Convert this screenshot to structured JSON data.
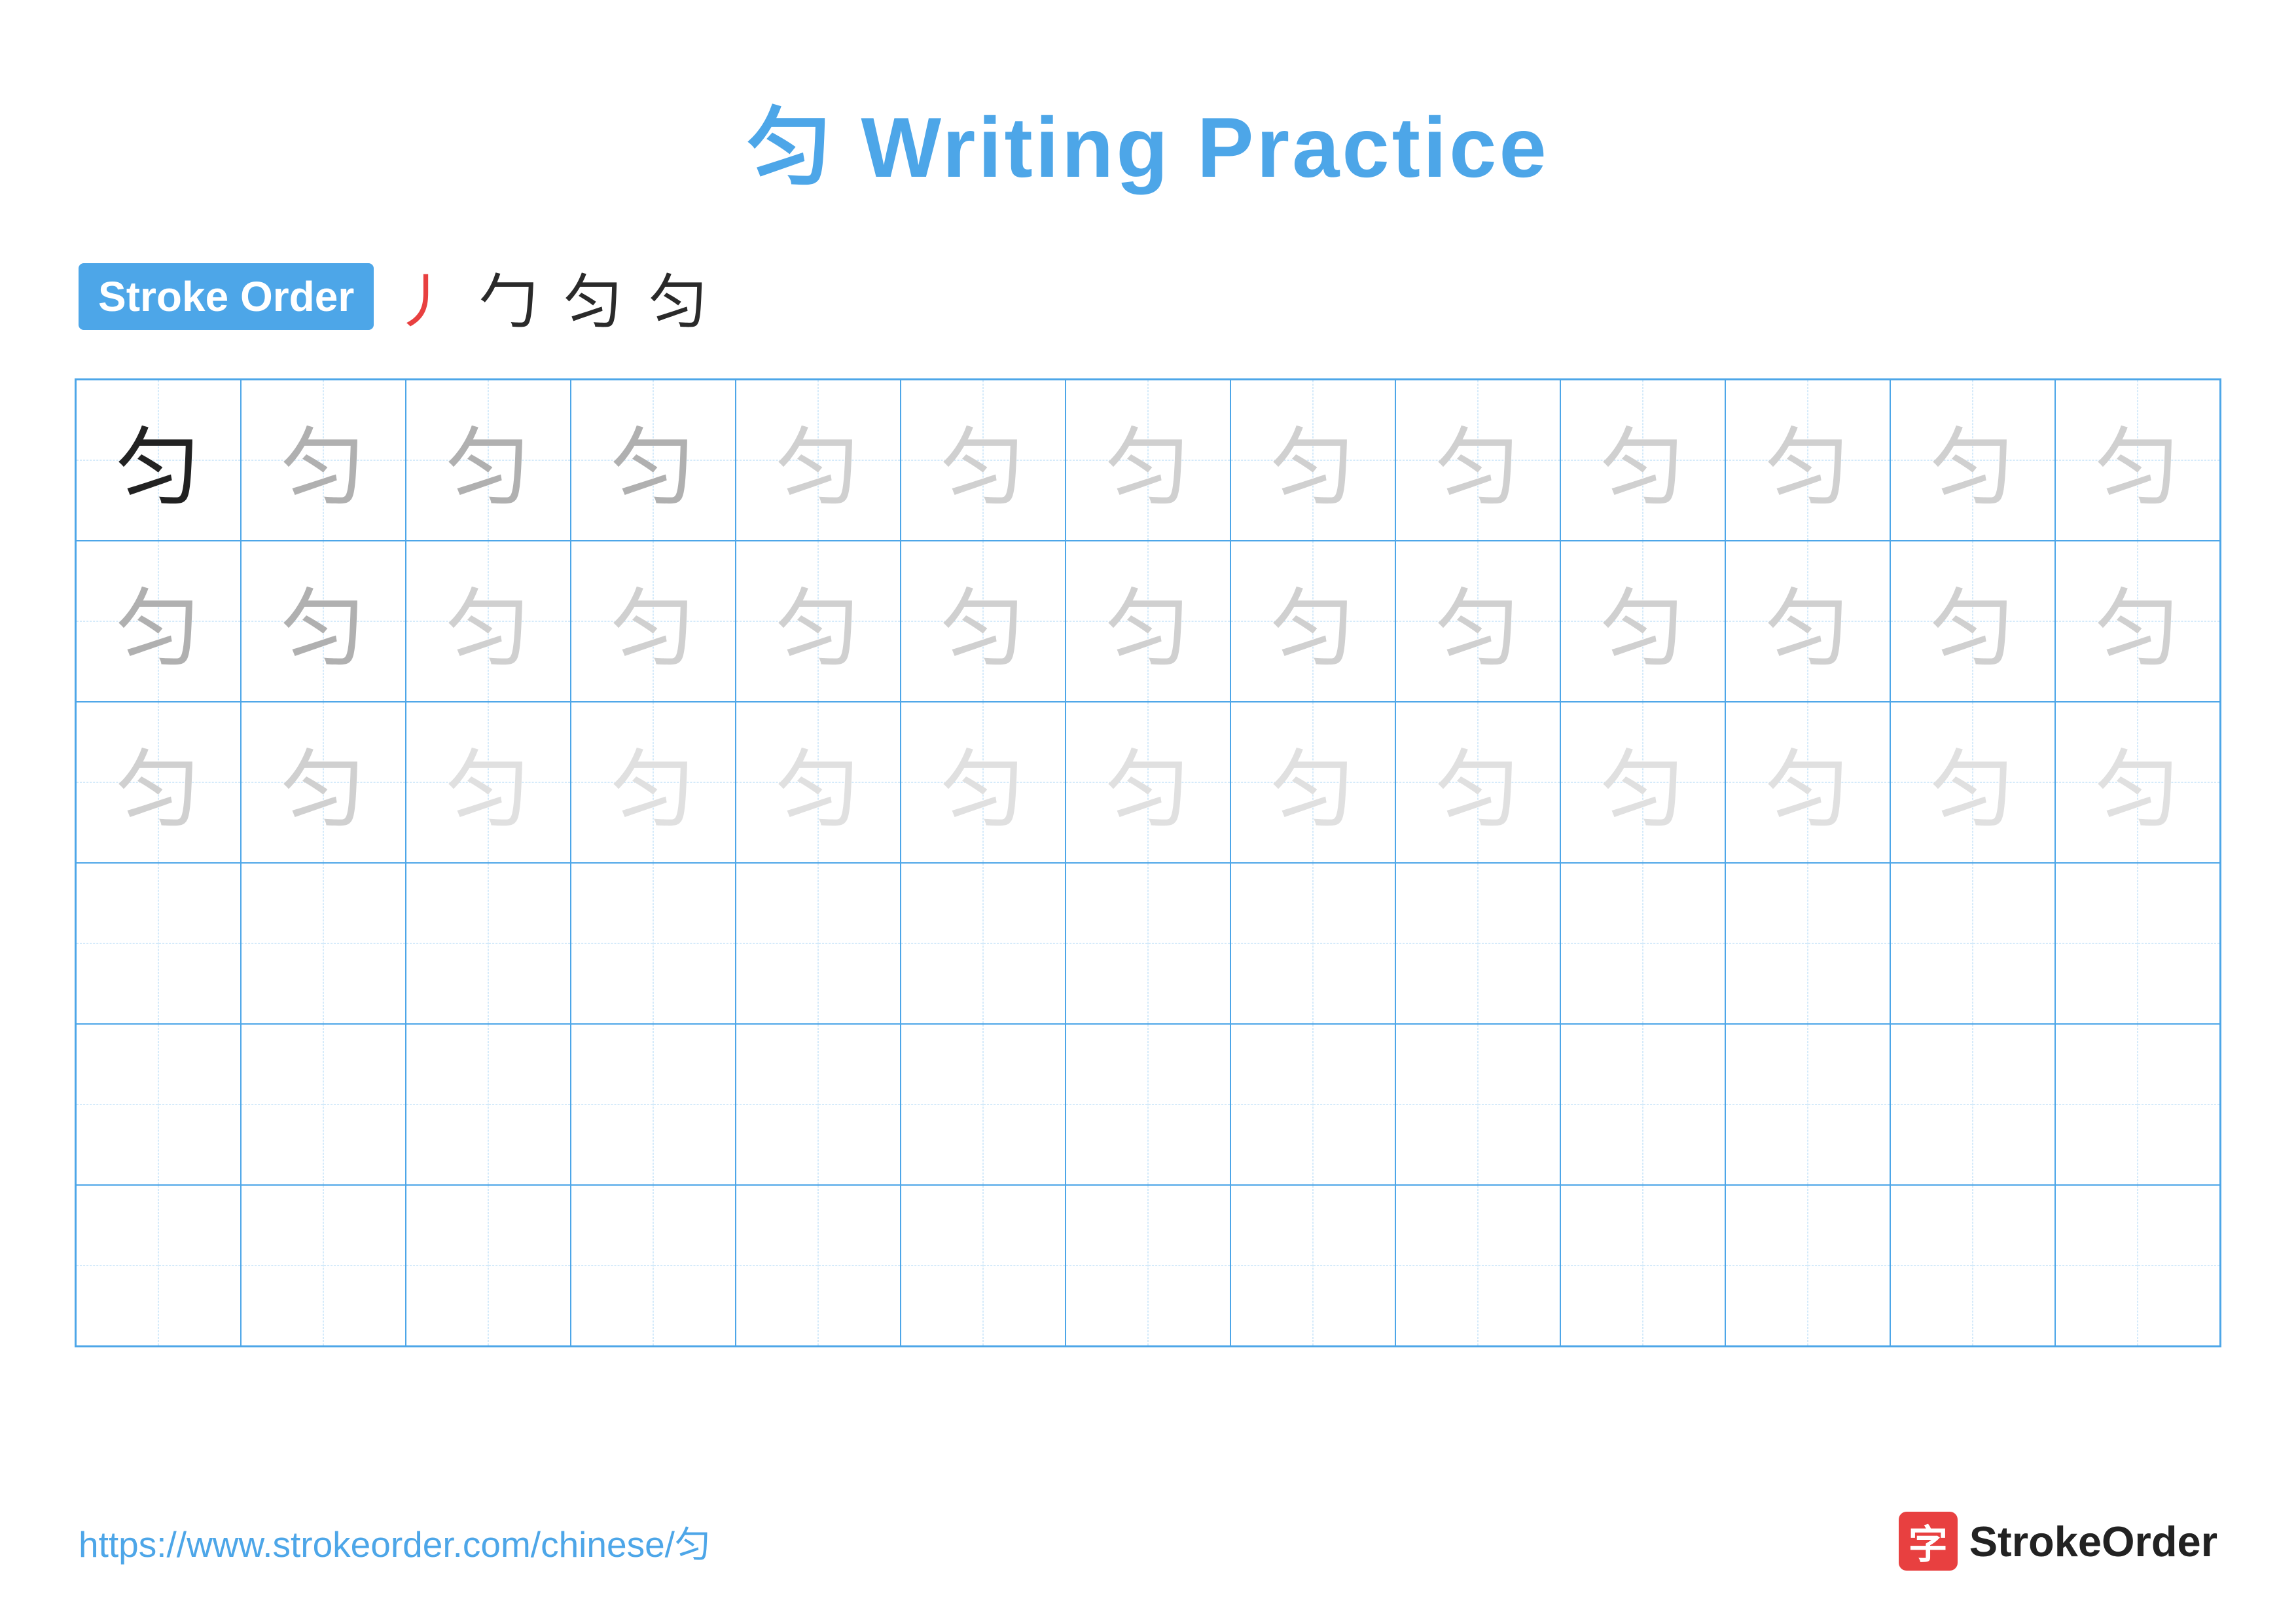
{
  "title": {
    "char": "匀",
    "text": "Writing Practice",
    "full": "匀 Writing Practice"
  },
  "stroke_order": {
    "badge_label": "Stroke Order",
    "steps": [
      "丿",
      "勹",
      "匀",
      "匀"
    ]
  },
  "grid": {
    "rows": 6,
    "cols": 13,
    "char": "匀",
    "row_configs": [
      {
        "type": "solid_then_medium",
        "solid_count": 1
      },
      {
        "type": "all_medium"
      },
      {
        "type": "all_light"
      },
      {
        "type": "empty"
      },
      {
        "type": "empty"
      },
      {
        "type": "empty"
      }
    ]
  },
  "footer": {
    "url": "https://www.strokeorder.com/chinese/匀",
    "logo_char": "字",
    "logo_text": "StrokeOrder"
  }
}
